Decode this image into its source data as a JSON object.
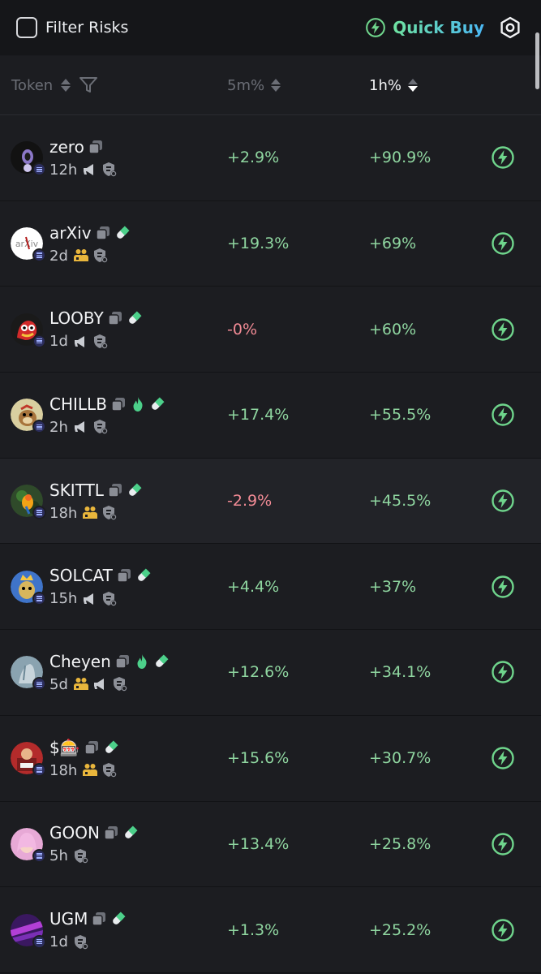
{
  "topbar": {
    "filter_label": "Filter Risks",
    "quickbuy_label": "Quick Buy"
  },
  "header": {
    "token": "Token",
    "m5": "5m%",
    "h1": "1h%"
  },
  "colors": {
    "positive": "#8fd6a0",
    "negative": "#f28b95",
    "accent": "#5ac8fa"
  },
  "rows": [
    {
      "name": "zero",
      "age": "12h",
      "m5": "+2.9%",
      "h1": "+90.9%",
      "m5_neg": false
    },
    {
      "name": "arXiv",
      "age": "2d",
      "m5": "+19.3%",
      "h1": "+69%",
      "m5_neg": false
    },
    {
      "name": "LOOBY",
      "age": "1d",
      "m5": "-0%",
      "h1": "+60%",
      "m5_neg": true
    },
    {
      "name": "CHILLB",
      "age": "2h",
      "m5": "+17.4%",
      "h1": "+55.5%",
      "m5_neg": false
    },
    {
      "name": "SKITTL",
      "age": "18h",
      "m5": "-2.9%",
      "h1": "+45.5%",
      "m5_neg": true
    },
    {
      "name": "SOLCAT",
      "age": "15h",
      "m5": "+4.4%",
      "h1": "+37%",
      "m5_neg": false
    },
    {
      "name": "Cheyen",
      "age": "5d",
      "m5": "+12.6%",
      "h1": "+34.1%",
      "m5_neg": false
    },
    {
      "name": "$🎰",
      "age": "18h",
      "m5": "+15.6%",
      "h1": "+30.7%",
      "m5_neg": false
    },
    {
      "name": "GOON",
      "age": "5h",
      "m5": "+13.4%",
      "h1": "+25.8%",
      "m5_neg": false
    },
    {
      "name": "UGM",
      "age": "1d",
      "m5": "+1.3%",
      "h1": "+25.2%",
      "m5_neg": false
    }
  ]
}
